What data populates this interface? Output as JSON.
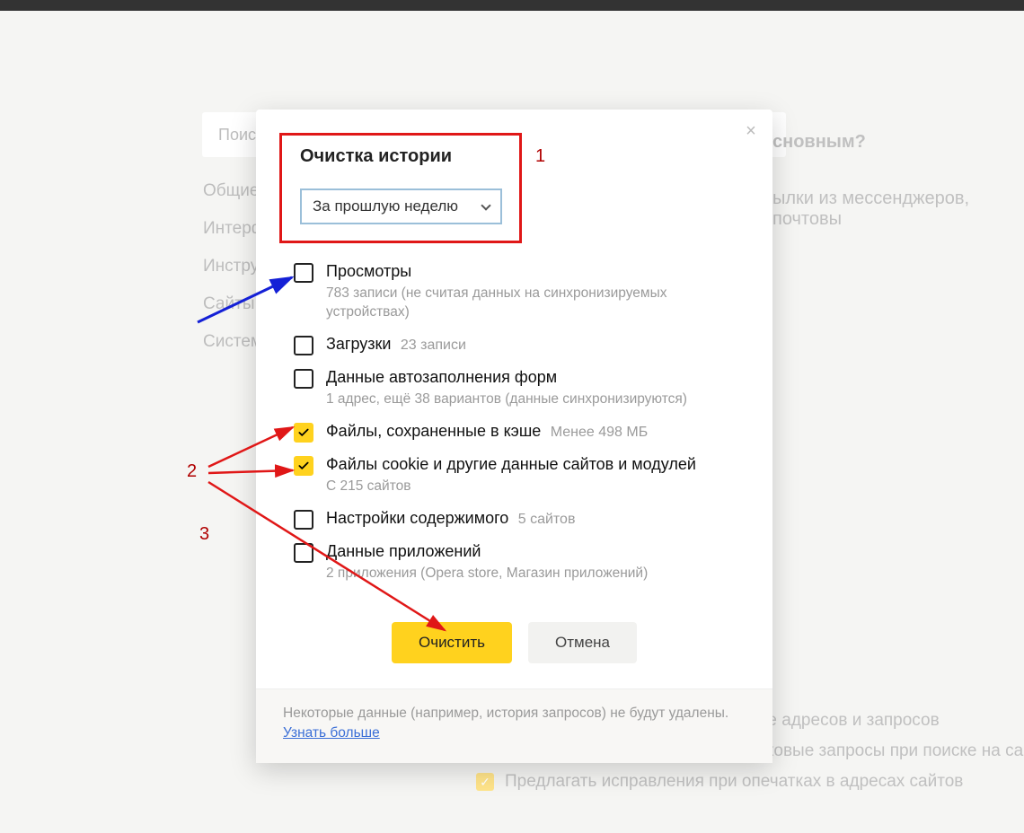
{
  "background": {
    "search_placeholder": "Поиск",
    "sidebar": [
      "Общие",
      "Интерф",
      "Инстру",
      "Сайты",
      "Систем"
    ],
    "right_question": "сновным?",
    "right_sub": "ылки из мессенджеров, почтовы",
    "bottom": [
      "Показывать подсказки при наборе адресов и запросов",
      "Показывать в Умной строке поисковые запросы при поиске на сай",
      "Предлагать исправления при опечатках в адресах сайтов"
    ]
  },
  "dialog": {
    "title": "Очистка истории",
    "time_range": "За прошлую неделю",
    "items": [
      {
        "label": "Просмотры",
        "sub": "783 записи (не считая данных на синхронизируемых устройствах)",
        "checked": false
      },
      {
        "label": "Загрузки",
        "inline_sub": "23 записи",
        "checked": false
      },
      {
        "label": "Данные автозаполнения форм",
        "sub": "1 адрес, ещё 38 вариантов (данные синхронизируются)",
        "checked": false
      },
      {
        "label": "Файлы, сохраненные в кэше",
        "inline_sub": "Менее 498 МБ",
        "checked": true
      },
      {
        "label": "Файлы cookie и другие данные сайтов и модулей",
        "sub": "С 215 сайтов",
        "checked": true
      },
      {
        "label": "Настройки содержимого",
        "inline_sub": "5 сайтов",
        "checked": false
      },
      {
        "label": "Данные приложений",
        "sub": "2 приложения (Opera store, Магазин приложений)",
        "checked": false
      }
    ],
    "clear_button": "Очистить",
    "cancel_button": "Отмена",
    "footer_text": "Некоторые данные (например, история запросов) не будут удалены.",
    "footer_link": "Узнать больше"
  },
  "annotations": {
    "n1": "1",
    "n2": "2",
    "n3": "3"
  }
}
